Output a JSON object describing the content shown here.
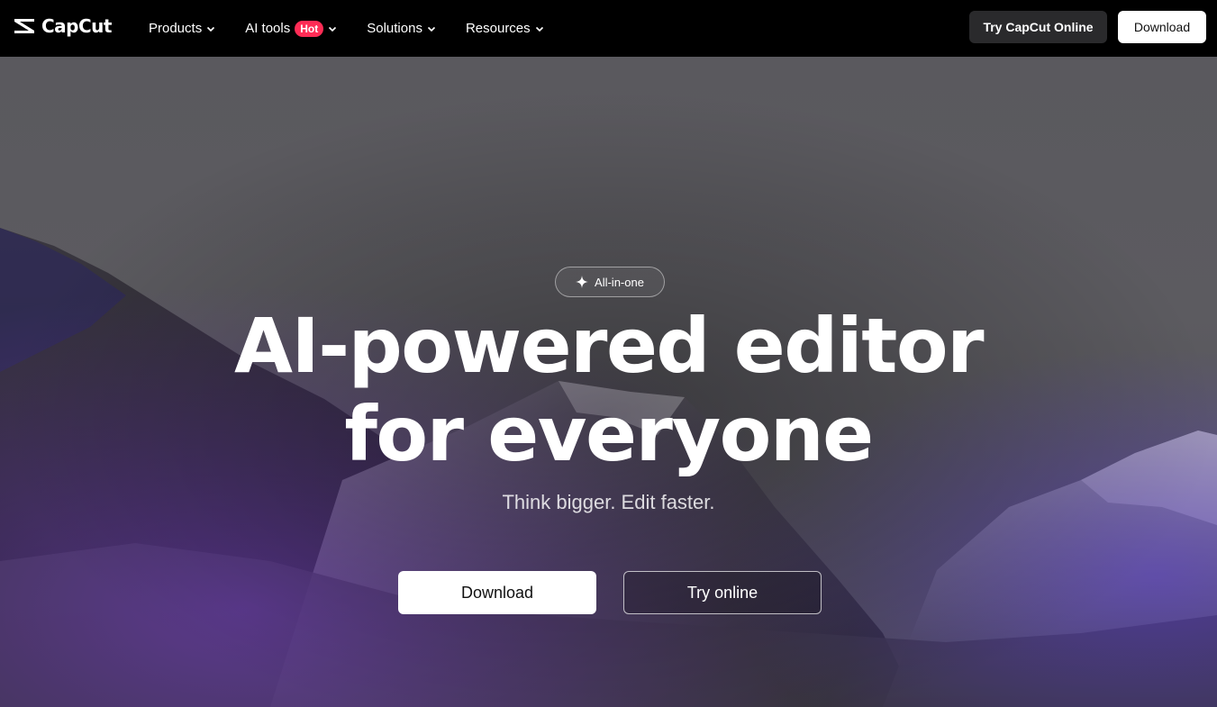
{
  "brand": {
    "name": "CapCut",
    "logo_icon": "capcut-logo-icon"
  },
  "nav": {
    "items": [
      {
        "label": "Products",
        "icon": "chevron-down-icon"
      },
      {
        "label": "AI tools",
        "badge": "Hot",
        "icon": "chevron-down-icon"
      },
      {
        "label": "Solutions",
        "icon": "chevron-down-icon"
      },
      {
        "label": "Resources",
        "icon": "chevron-down-icon"
      }
    ],
    "try_online_label": "Try CapCut Online",
    "download_label": "Download"
  },
  "hero": {
    "pill_label": "All-in-one",
    "pill_icon": "sparkle-icon",
    "headline_line1": "AI-powered editor",
    "headline_line2": "for everyone",
    "subheadline": "Think bigger. Edit faster.",
    "download_label": "Download",
    "try_online_label": "Try online"
  },
  "colors": {
    "topbar": "#000000",
    "hot_badge": "#fe2c55",
    "accent_purple": "#6b3fd6"
  }
}
